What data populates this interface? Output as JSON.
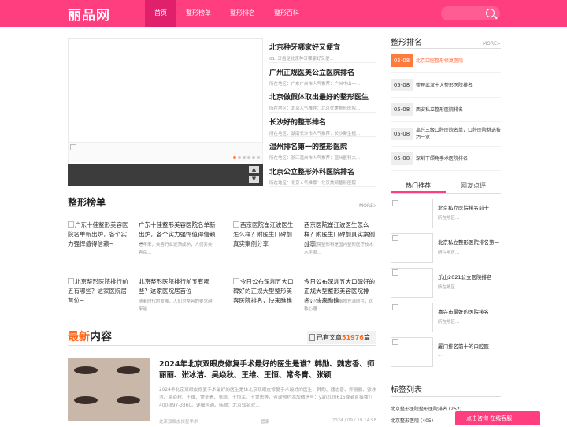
{
  "header": {
    "logo": "丽品网",
    "nav": [
      "首页",
      "整形榜单",
      "整形排名",
      "整形百科"
    ]
  },
  "news": [
    {
      "title": "北京种牙哪家好又便宜",
      "desc": "01. 牙齿是北京种牙哪家好又便..."
    },
    {
      "title": "广州正规医美公立医院排名",
      "desc": "所在地区：广东广州市人气推荐：广州中山一..."
    },
    {
      "title": "北京做假体取出最好的整形医生",
      "desc": "所在地区：北京人气推荐：北京优美整形医院..."
    },
    {
      "title": "长沙好的整形排名",
      "desc": "所在地区：湖南长沙市人气推荐：长沙新生植..."
    },
    {
      "title": "温州排名第一的整形医院",
      "desc": "所在地区：浙江温州市人气推荐：温州医科大..."
    },
    {
      "title": "北京公立整形外科医院排名",
      "desc": "所在地区：北京人气推荐：北京美颜整形医院..."
    }
  ],
  "ranking_section": {
    "title": "整形排名",
    "more": "MORE>",
    "items": [
      {
        "date": "05-08",
        "text": "北京口腔整形修复医院"
      },
      {
        "date": "05-08",
        "text": "整理武汉十大整形医院排名"
      },
      {
        "date": "05-08",
        "text": "西安私立整形医院排名"
      },
      {
        "date": "05-08",
        "text": "嘉兴三级口腔医院名单，口腔医院挑选技巧一览"
      },
      {
        "date": "05-08",
        "text": "深圳下颌角手术医院排名"
      }
    ]
  },
  "tabs": [
    "热门推荐",
    "网友点评"
  ],
  "hot": [
    {
      "title": "北京私立医院排名前十",
      "desc": "所在地区..."
    },
    {
      "title": "北京私立整形医院排名第一",
      "desc": "所在地区..."
    },
    {
      "title": "乐山2021公立医院排名",
      "desc": "所在地区..."
    },
    {
      "title": "嘉兴市最好的医院排名",
      "desc": "所在地区..."
    },
    {
      "title": "厦门排名前十的口腔医",
      "desc": "..."
    }
  ],
  "tags": {
    "title": "标签列表",
    "items": [
      "北京整形医院整形医院排名 (252)",
      "北京整形医院 (405)"
    ]
  },
  "bang": {
    "title": "整形榜单",
    "more": "MORE>",
    "items": [
      {
        "img_alt": "广东十佳整形美容医院名单新出炉，各个实力强悍值得信赖~",
        "title": "广东十佳整形美容医院名单新出炉，各个实力强悍值得信赖~",
        "desc": "近年来，美容行业逐渐成熟，人们对美容保..."
      },
      {
        "img_alt": "西京医院崔江波医生怎么样？附医生口碑加真实案例分享",
        "title": "西京医院崔江波医生怎么样？附医生口碑加真实案例分享",
        "desc": "西京医院整形科是国内整形医疗技术水平很..."
      },
      {
        "img_alt": "北京整形医院排行前五有哪些？这家医院居首位~",
        "title": "北京整形医院排行前五有哪些？这家医院居首位~",
        "desc": "随着时代的发展，人们对整容的要求越来越..."
      },
      {
        "img_alt": "今日公布深圳五大口碑好的正规大型整形美容医院排名，快来瞧瞧",
        "title": "今日公布深圳五大口碑好的正规大型整形美容医院排名，快来瞧瞧",
        "desc": "每个人都对最好的事物充满向往，这种心理..."
      }
    ]
  },
  "latest": {
    "title_red": "最新",
    "title_black": "内容",
    "count_prefix": "已有文章",
    "count": "51976",
    "count_suffix": "篇",
    "article": {
      "title": "2024年北京双眼皮修复手术最好的医生是谁？韩勋、魏志香、师丽丽、张冰洁、吴焱秋、王维、王恒、常冬青、张颖",
      "desc": "2024年北京双眼皮修复手术最好的医生是谁北京双眼皮修复手术最好的医生：韩勋、魏志香、师丽丽、张冰洁、吴焱秋、王维、常冬青、张颖、王恒军、王世勇等，咨询预约添加微信号：yanzi20615或者直接拨打400-897-3360。详细沟通。韩勋：北京知名双...",
      "category": "北京双眼皮修复手术",
      "author": "管家",
      "date": "2024 / 09 / 19 14:58"
    }
  },
  "consult": "点击咨询 在线客服"
}
